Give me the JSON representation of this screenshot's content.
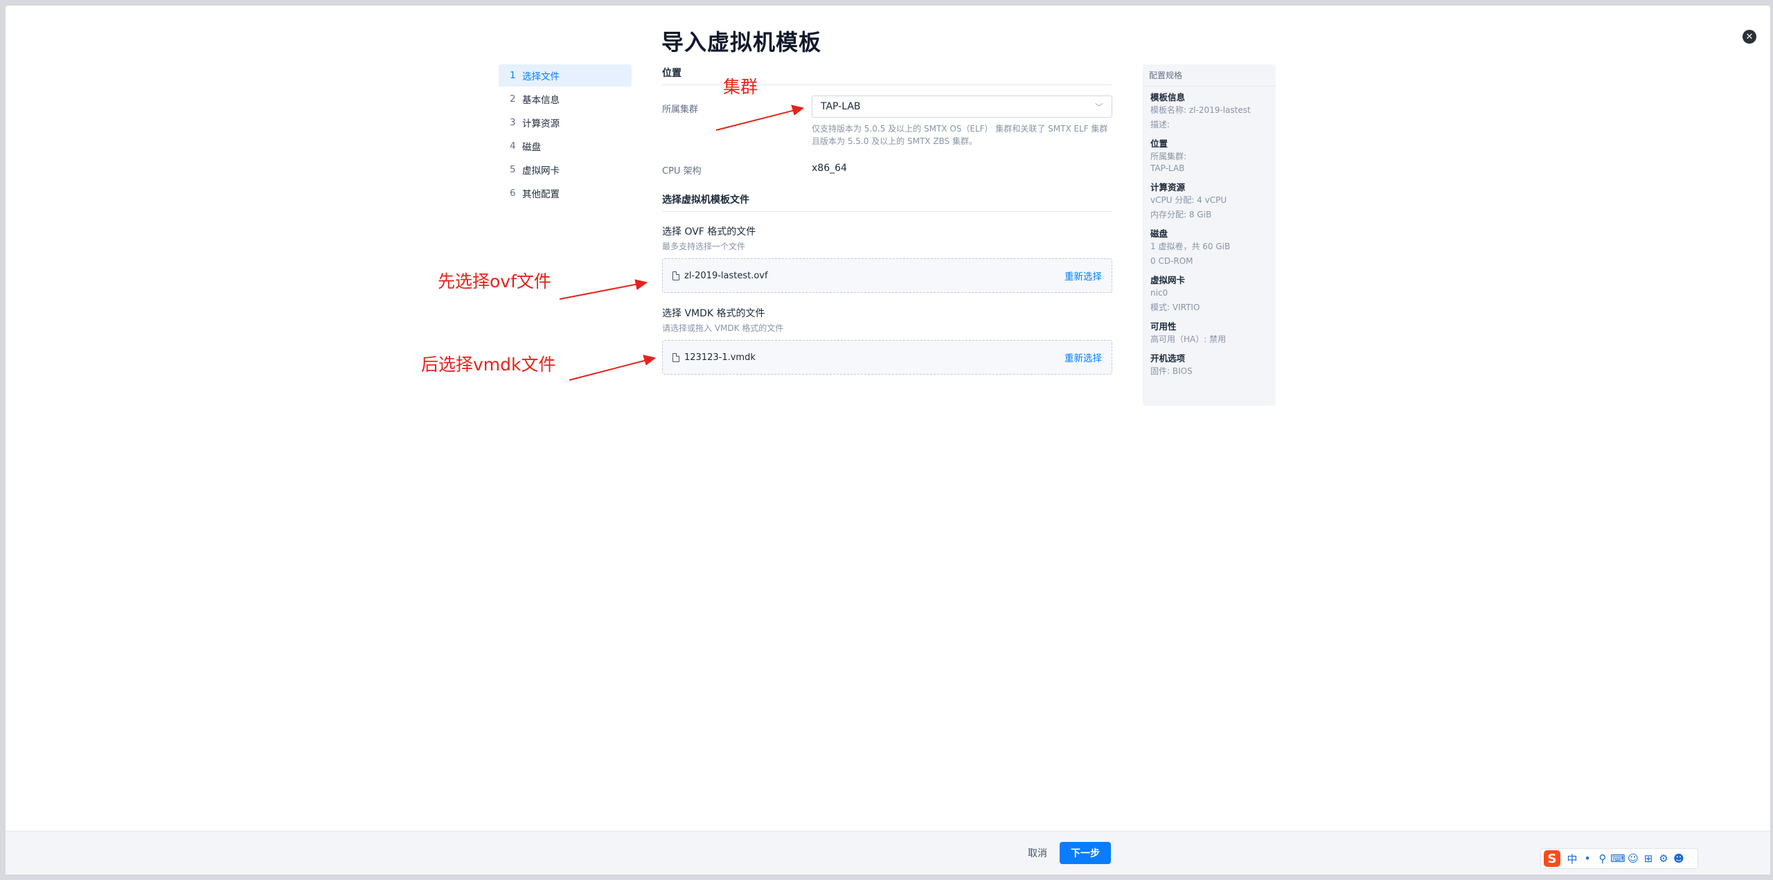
{
  "dialog": {
    "title": "导入虚拟机模板",
    "close_icon": "close-icon"
  },
  "steps": [
    {
      "num": "1",
      "label": "选择文件",
      "active": true
    },
    {
      "num": "2",
      "label": "基本信息",
      "active": false
    },
    {
      "num": "3",
      "label": "计算资源",
      "active": false
    },
    {
      "num": "4",
      "label": "磁盘",
      "active": false
    },
    {
      "num": "5",
      "label": "虚拟网卡",
      "active": false
    },
    {
      "num": "6",
      "label": "其他配置",
      "active": false
    }
  ],
  "location": {
    "section_title": "位置",
    "cluster_label": "所属集群",
    "cluster_value": "TAP-LAB",
    "hint_line1": "仅支持版本为 5.0.5 及以上的 SMTX OS（ELF） 集群和关联了 SMTX ELF 集群",
    "hint_line2": "且版本为 5.5.0 及以上的 SMTX ZBS 集群。",
    "cpu_label": "CPU 架构",
    "cpu_value": "x86_64"
  },
  "files": {
    "section_title": "选择虚拟机模板文件",
    "ovf_label": "选择 OVF 格式的文件",
    "ovf_hint": "最多支持选择一个文件",
    "ovf_file": "zl-2019-lastest.ovf",
    "ovf_reselect": "重新选择",
    "vmdk_label": "选择 VMDK 格式的文件",
    "vmdk_hint": "请选择或拖入 VMDK 格式的文件",
    "vmdk_file": "123123-1.vmdk",
    "vmdk_reselect": "重新选择"
  },
  "summary": {
    "title": "配置规格",
    "template_info_title": "模板信息",
    "template_name": "模板名称: zl-2019-lastest",
    "template_desc": "描述:",
    "location_title": "位置",
    "location_cluster_label": "所属集群:",
    "location_cluster_value": "TAP-LAB",
    "compute_title": "计算资源",
    "compute_vcpu": "vCPU 分配: 4 vCPU",
    "compute_mem": "内存分配: 8 GiB",
    "disk_title": "磁盘",
    "disk_volumes": "1 虚拟卷，共 60 GiB",
    "disk_cdrom": "0 CD-ROM",
    "nic_title": "虚拟网卡",
    "nic_name": "nic0",
    "nic_mode": "模式: VIRTIO",
    "ha_title": "可用性",
    "ha_value": "高可用（HA）: 禁用",
    "boot_title": "开机选项",
    "boot_value": "固件: BIOS"
  },
  "annotations": {
    "cluster": "集群",
    "ovf": "先选择ovf文件",
    "vmdk": "后选择vmdk文件",
    "color": "#e8221b"
  },
  "footer": {
    "cancel": "取消",
    "next": "下一步"
  },
  "ime": {
    "logo": "S",
    "items": [
      "中",
      "•",
      "⚲",
      "⌨",
      "☺",
      "⊞",
      "⚙",
      "☻"
    ]
  }
}
